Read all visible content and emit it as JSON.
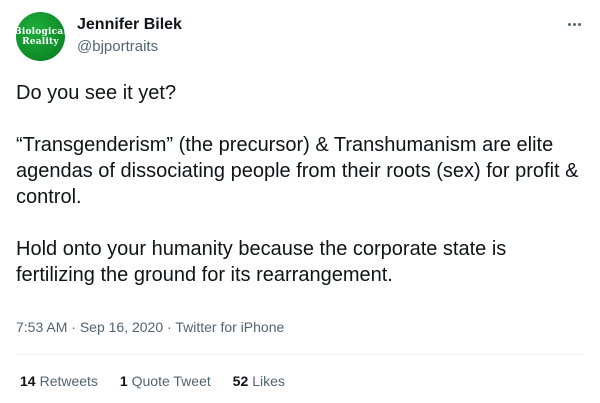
{
  "author": {
    "avatar_text_line1": "Biological",
    "avatar_text_line2": "Reality",
    "name": "Jennifer Bilek",
    "handle": "@bjportraits"
  },
  "tweet": {
    "paragraphs": [
      "Do you see it yet?",
      "“Transgenderism” (the precursor) & Transhumanism are elite agendas of dissociating people from their roots (sex) for profit & control.",
      "Hold onto your humanity because the corporate state is fertilizing the ground for its rearrangement."
    ],
    "time": "7:53 AM",
    "date": "Sep 16, 2020",
    "source": "Twitter for iPhone",
    "separator": "·"
  },
  "stats": {
    "retweets_count": "14",
    "retweets_label": "Retweets",
    "quotes_count": "1",
    "quotes_label": "Quote Tweet",
    "likes_count": "52",
    "likes_label": "Likes"
  },
  "icons": {
    "more": "more-dots-icon"
  },
  "colors": {
    "avatar_green": "#0e8a27",
    "secondary_text": "#536471",
    "primary_text": "#0f1419"
  }
}
